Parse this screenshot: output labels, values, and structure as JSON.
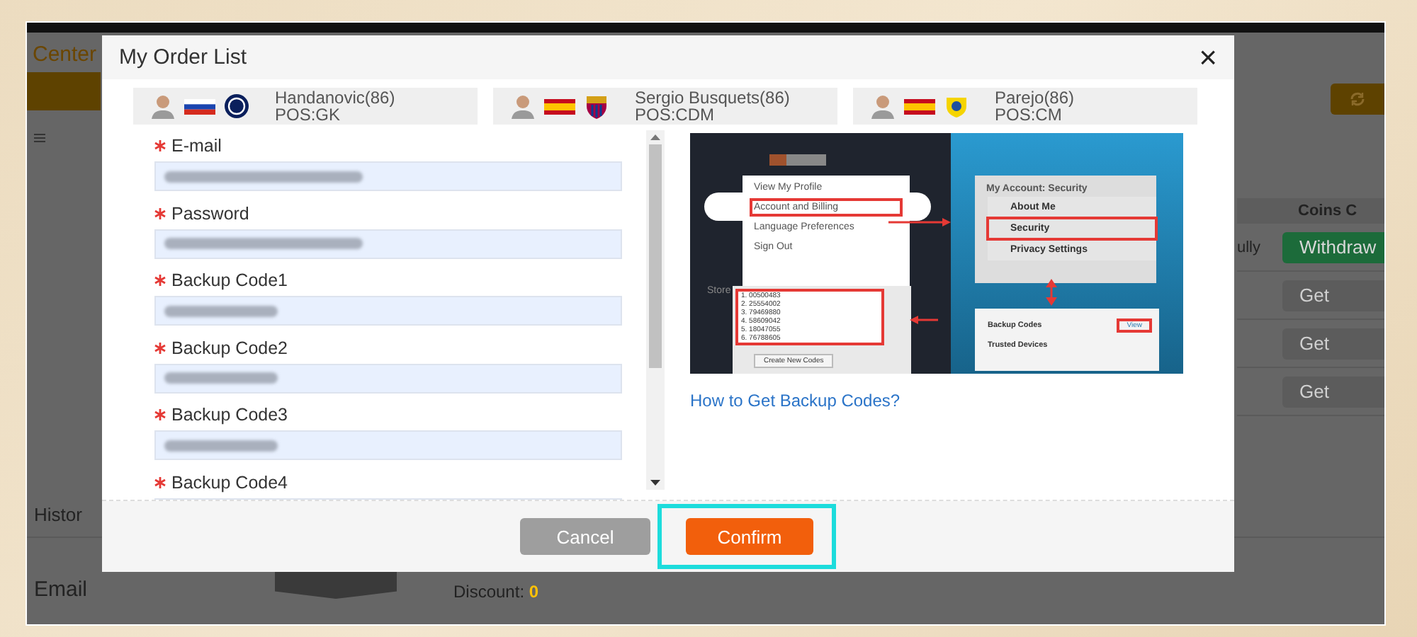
{
  "background_page": {
    "header_text": "Center",
    "history_label": "Histor",
    "email_label": "Email",
    "discount": {
      "label": "Discount:",
      "value": "0"
    },
    "table": {
      "header": "Coins C",
      "rows": [
        {
          "status": "ully",
          "action": "Withdraw",
          "kind": "withdraw"
        },
        {
          "status": "",
          "action": "Get",
          "kind": "get"
        },
        {
          "status": "",
          "action": "Get",
          "kind": "get"
        },
        {
          "status": "",
          "action": "Get",
          "kind": "get"
        }
      ]
    }
  },
  "dialog": {
    "title": "My Order List",
    "close": "×",
    "players": [
      {
        "name": "Handanovic(86)",
        "position": "POS:GK",
        "flag": {
          "kind": "slovenia"
        },
        "club": {
          "kind": "inter"
        }
      },
      {
        "name": "Sergio Busquets(86)",
        "position": "POS:CDM",
        "flag": {
          "kind": "spain"
        },
        "club": {
          "kind": "barcelona"
        }
      },
      {
        "name": "Parejo(86)",
        "position": "POS:CM",
        "flag": {
          "kind": "spain"
        },
        "club": {
          "kind": "villarreal"
        }
      }
    ],
    "fields": [
      {
        "label": "E-mail",
        "required": true
      },
      {
        "label": "Password",
        "required": true
      },
      {
        "label": "Backup Code1",
        "required": true
      },
      {
        "label": "Backup Code2",
        "required": true
      },
      {
        "label": "Backup Code3",
        "required": true
      },
      {
        "label": "Backup Code4",
        "required": true
      }
    ],
    "tutorial": {
      "menu_items": [
        {
          "label": "View My Profile",
          "highlighted": false
        },
        {
          "label": "Account and Billing",
          "highlighted": true
        },
        {
          "label": "Language Preferences",
          "highlighted": false
        },
        {
          "label": "Sign Out",
          "highlighted": false
        }
      ],
      "sidebar_text": "Store",
      "security_title": "My Account: Security",
      "security_items": [
        {
          "label": "About Me",
          "highlighted": false
        },
        {
          "label": "Security",
          "highlighted": true
        },
        {
          "label": "Privacy Settings",
          "highlighted": false
        }
      ],
      "codes": [
        "1. 00500483",
        "2. 25554002",
        "3. 79469880",
        "4. 58609042",
        "5. 18047055",
        "6. 76788605"
      ],
      "create_button": "Create New Codes",
      "backup_rows": [
        {
          "label": "Backup Codes",
          "action": "View"
        },
        {
          "label": "Trusted Devices",
          "action": ""
        }
      ]
    },
    "help_link": "How to Get Backup Codes?",
    "buttons": [
      {
        "label": "Cancel",
        "kind": "secondary",
        "disabled": true,
        "highlighted": false
      },
      {
        "label": "Confirm",
        "kind": "primary",
        "disabled": false,
        "highlighted": true
      }
    ]
  }
}
